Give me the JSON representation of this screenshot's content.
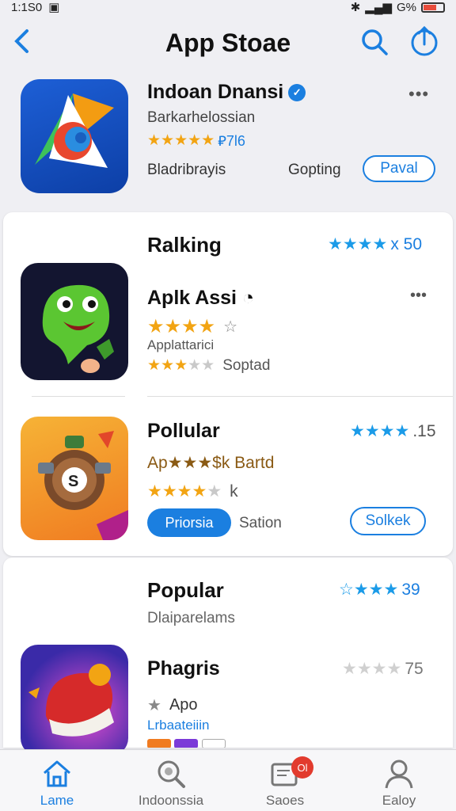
{
  "status": {
    "time": "1:1S0",
    "battery": "G%"
  },
  "header": {
    "title": "App Stoae"
  },
  "featured": {
    "name": "Indoan Dnansi",
    "subtitle": "Barkarhelossian",
    "stars": "★★★★★",
    "rating": "⃆7l6",
    "developer": "Bladribrayis",
    "status": "Gopting",
    "button": "Paval"
  },
  "ranking": {
    "title": "Ralking",
    "stars": "★★★★",
    "rating": "x 50",
    "app": {
      "name": "Aplk Assi",
      "stars": "★★★★",
      "star_extra": "☆",
      "category": "Applattarici",
      "stars2": "★★★",
      "stars2_grey": "★★",
      "note": "Soptad"
    }
  },
  "popular1": {
    "title": "Pollular",
    "stars": "★★★★",
    "rating": ".15",
    "app_label": "Ap★★★$k Bartd",
    "stars_grey": "★",
    "extra": "k",
    "btn_filled": "Priorsia",
    "status": "Sation",
    "btn_outline": "Solkek"
  },
  "popular2": {
    "title": "Popular",
    "stars": "☆★★★",
    "rating": "39",
    "subtitle": "Dlaiparelams",
    "app": {
      "name": "Phagris",
      "stars_grey": "★★★★",
      "rating": "75",
      "label": "Apo",
      "category": "Lrbaateiiin"
    }
  },
  "tabs": [
    {
      "label": "Lame",
      "icon": "home-icon"
    },
    {
      "label": "Indoonssia",
      "icon": "search-icon"
    },
    {
      "label": "Saoes",
      "icon": "updates-icon",
      "badge": "Ol"
    },
    {
      "label": "Ealoy",
      "icon": "profile-icon"
    }
  ],
  "colors": {
    "accent": "#1b7fe0",
    "star": "#f2a413",
    "badge": "#e23b2e"
  }
}
